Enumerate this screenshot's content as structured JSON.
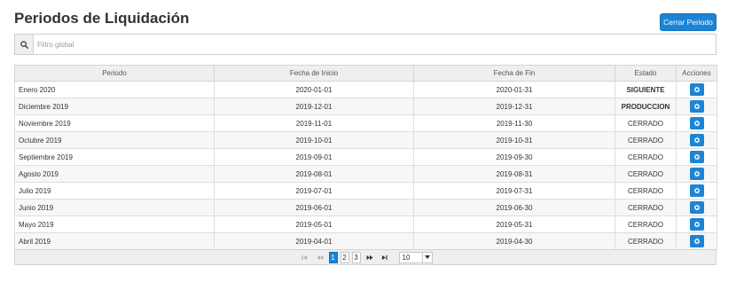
{
  "header": {
    "title": "Periodos de Liquidación",
    "close_button_label": "Cerrar Periodo"
  },
  "filter": {
    "placeholder": "Filtro global",
    "value": "",
    "icon": "search-icon"
  },
  "table": {
    "columns": [
      "Periodo",
      "Fecha de Inicio",
      "Fecha de Fin",
      "Estado",
      "Acciones"
    ],
    "rows": [
      {
        "periodo": "Enero 2020",
        "inicio": "2020-01-01",
        "fin": "2020-01-31",
        "estado": "SIGUIENTE",
        "bold": true
      },
      {
        "periodo": "Diciembre 2019",
        "inicio": "2019-12-01",
        "fin": "2019-12-31",
        "estado": "PRODUCCION",
        "bold": true
      },
      {
        "periodo": "Noviembre 2019",
        "inicio": "2019-11-01",
        "fin": "2019-11-30",
        "estado": "CERRADO",
        "bold": false
      },
      {
        "periodo": "Octubre 2019",
        "inicio": "2019-10-01",
        "fin": "2019-10-31",
        "estado": "CERRADO",
        "bold": false
      },
      {
        "periodo": "Septiembre 2019",
        "inicio": "2019-09-01",
        "fin": "2019-09-30",
        "estado": "CERRADO",
        "bold": false
      },
      {
        "periodo": "Agosto 2019",
        "inicio": "2019-08-01",
        "fin": "2019-08-31",
        "estado": "CERRADO",
        "bold": false
      },
      {
        "periodo": "Julio 2019",
        "inicio": "2019-07-01",
        "fin": "2019-07-31",
        "estado": "CERRADO",
        "bold": false
      },
      {
        "periodo": "Junio 2019",
        "inicio": "2019-06-01",
        "fin": "2019-06-30",
        "estado": "CERRADO",
        "bold": false
      },
      {
        "periodo": "Mayo 2019",
        "inicio": "2019-05-01",
        "fin": "2019-05-31",
        "estado": "CERRADO",
        "bold": false
      },
      {
        "periodo": "Abril 2019",
        "inicio": "2019-04-01",
        "fin": "2019-04-30",
        "estado": "CERRADO",
        "bold": false
      }
    ],
    "action_icon": "gear-icon"
  },
  "pagination": {
    "pages": [
      "1",
      "2",
      "3"
    ],
    "current_page": "1",
    "rows_per_page": "10",
    "icons": [
      "first-page-icon",
      "prev-page-icon",
      "next-page-icon",
      "last-page-icon",
      "dropdown-caret-icon"
    ]
  },
  "colors": {
    "accent": "#1b84d6",
    "header_bg": "#efefef",
    "row_alt": "#f7f7f7"
  }
}
